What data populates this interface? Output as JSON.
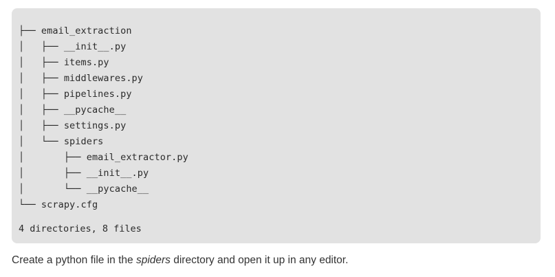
{
  "tree": {
    "lines": [
      "├── email_extraction",
      "│   ├── __init__.py",
      "│   ├── items.py",
      "│   ├── middlewares.py",
      "│   ├── pipelines.py",
      "│   ├── __pycache__",
      "│   ├── settings.py",
      "│   └── spiders",
      "│       ├── email_extractor.py",
      "│       ├── __init__.py",
      "│       └── __pycache__",
      "└── scrapy.cfg"
    ],
    "summary": "4 directories, 8 files"
  },
  "caption": {
    "before": "Create a python file in the ",
    "emphasis": "spiders",
    "after": " directory and open it up in any editor."
  }
}
